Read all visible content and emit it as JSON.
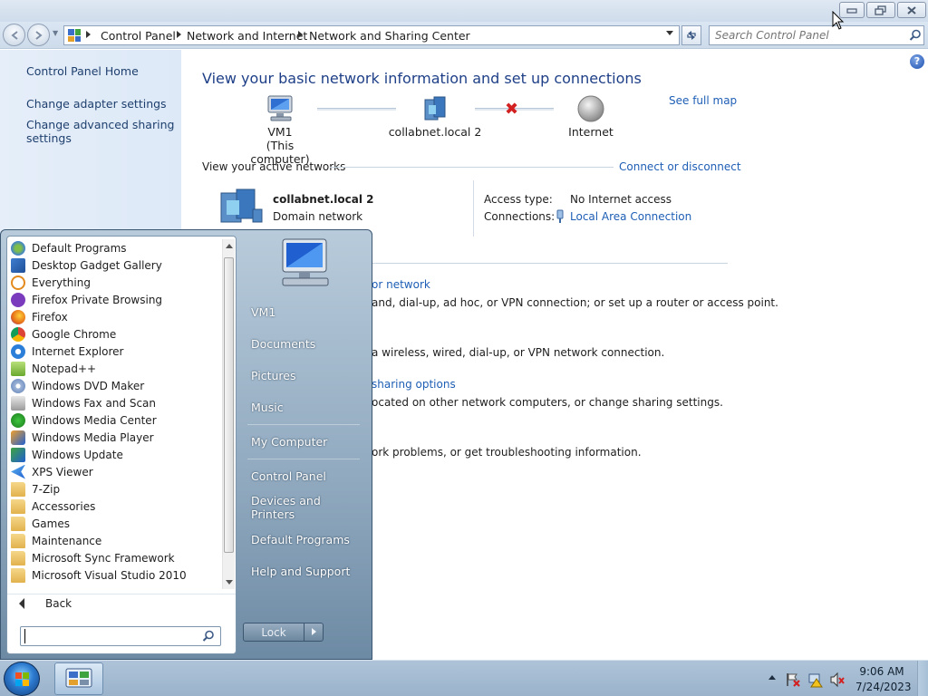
{
  "window": {
    "breadcrumb": [
      "Control Panel",
      "Network and Internet",
      "Network and Sharing Center"
    ],
    "search_placeholder": "Search Control Panel"
  },
  "left_nav": {
    "items": [
      {
        "label": "Control Panel Home"
      },
      {
        "label": "Change adapter settings"
      },
      {
        "label": "Change advanced sharing settings",
        "lines": [
          "Change advanced sharing",
          "settings"
        ]
      }
    ]
  },
  "main": {
    "title": "View your basic network information and set up connections",
    "see_full_map": "See full map",
    "map": {
      "computer_name": "VM1",
      "computer_sub": "(This computer)",
      "network": "collabnet.local  2",
      "internet": "Internet"
    },
    "active_networks_label": "View your active networks",
    "connect_disconnect": "Connect or disconnect",
    "network": {
      "name": "collabnet.local  2",
      "type": "Domain network",
      "access_type_label": "Access type:",
      "access_type_value": "No Internet access",
      "connections_label": "Connections:",
      "connections_value": "Local Area Connection"
    },
    "tasks": [
      {
        "link_fragment": "or network",
        "desc_fragment": "and, dial-up, ad hoc, or VPN connection; or set up a router or access point."
      },
      {
        "desc_fragment": "a wireless, wired, dial-up, or VPN network connection."
      },
      {
        "link_fragment": "sharing options",
        "desc_fragment": "ocated on other network computers, or change sharing settings."
      },
      {
        "desc_fragment": "ork problems, or get troubleshooting information."
      }
    ]
  },
  "start_menu": {
    "programs": [
      {
        "label": "Default Programs",
        "icon": "default-programs-icon"
      },
      {
        "label": "Desktop Gadget Gallery",
        "icon": "gadget-icon"
      },
      {
        "label": "Everything",
        "icon": "everything-icon"
      },
      {
        "label": "Firefox Private Browsing",
        "icon": "firefox-private-icon"
      },
      {
        "label": "Firefox",
        "icon": "firefox-icon"
      },
      {
        "label": "Google Chrome",
        "icon": "chrome-icon"
      },
      {
        "label": "Internet Explorer",
        "icon": "ie-icon"
      },
      {
        "label": "Notepad++",
        "icon": "notepadpp-icon"
      },
      {
        "label": "Windows DVD Maker",
        "icon": "dvd-maker-icon"
      },
      {
        "label": "Windows Fax and Scan",
        "icon": "fax-scan-icon"
      },
      {
        "label": "Windows Media Center",
        "icon": "media-center-icon"
      },
      {
        "label": "Windows Media Player",
        "icon": "media-player-icon"
      },
      {
        "label": "Windows Update",
        "icon": "windows-update-icon"
      },
      {
        "label": "XPS Viewer",
        "icon": "xps-viewer-icon"
      },
      {
        "label": "7-Zip",
        "icon": "folder-icon"
      },
      {
        "label": "Accessories",
        "icon": "folder-icon"
      },
      {
        "label": "Games",
        "icon": "folder-icon"
      },
      {
        "label": "Maintenance",
        "icon": "folder-icon"
      },
      {
        "label": "Microsoft Sync Framework",
        "icon": "folder-icon"
      },
      {
        "label": "Microsoft Visual Studio 2010",
        "icon": "folder-icon"
      }
    ],
    "back_label": "Back",
    "search_value": "",
    "right_items": [
      "VM1",
      "Documents",
      "Pictures",
      "Music",
      "My Computer",
      "Control Panel",
      "Devices and Printers",
      "Default Programs",
      "Help and Support"
    ],
    "lock_label": "Lock"
  },
  "taskbar": {
    "time": "9:06 AM",
    "date": "7/24/2023"
  },
  "colors": {
    "link": "#1e5eb5",
    "title": "#1e3f87",
    "left_nav_bg": "#e1ebf8",
    "taskbar": "#a5bcd3",
    "start_menu_right": "#8fa8be"
  }
}
